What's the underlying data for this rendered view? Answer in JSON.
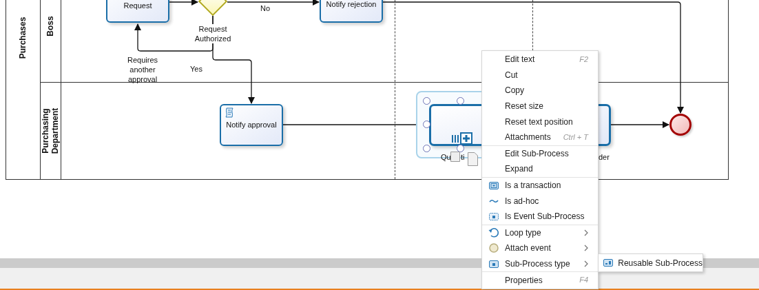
{
  "diagram": {
    "pool": {
      "label": "Purchases"
    },
    "lanes": [
      {
        "label": "Boss"
      },
      {
        "label": "Purchasing Department"
      }
    ],
    "nodes": [
      {
        "kind": "task",
        "label": "Request"
      },
      {
        "kind": "gateway",
        "label": "Request Authorized"
      },
      {
        "kind": "task",
        "label": "Notify rejection"
      },
      {
        "kind": "script-task",
        "label": "Notify approval"
      },
      {
        "kind": "subprocess",
        "selected": true,
        "label_fragments": [
          "Qu",
          "ti",
          "der"
        ]
      },
      {
        "kind": "end-event"
      }
    ],
    "flow_labels": [
      {
        "text": "No"
      },
      {
        "text": "Requires another approval"
      },
      {
        "text": "Yes"
      }
    ]
  },
  "context_menu": {
    "groups": [
      [
        {
          "kind": "plain",
          "label": "Edit text",
          "shortcut": "F2",
          "has_submenu": false
        },
        {
          "kind": "plain",
          "label": "Cut",
          "has_submenu": false
        },
        {
          "kind": "plain",
          "label": "Copy",
          "has_submenu": false
        },
        {
          "kind": "plain",
          "label": "Reset size",
          "has_submenu": false
        },
        {
          "kind": "plain",
          "label": "Reset text position",
          "has_submenu": false
        },
        {
          "kind": "plain",
          "label": "Attachments",
          "shortcut": "Ctrl + T",
          "has_submenu": false
        }
      ],
      [
        {
          "kind": "plain",
          "label": "Edit Sub-Process",
          "has_submenu": false
        },
        {
          "kind": "plain",
          "label": "Expand",
          "has_submenu": false
        }
      ],
      [
        {
          "kind": "transaction",
          "label": "Is a transaction",
          "has_submenu": false
        },
        {
          "kind": "ad-hoc",
          "label": "Is ad-hoc",
          "has_submenu": false
        },
        {
          "kind": "event-subprocess",
          "label": "Is Event Sub-Process",
          "has_submenu": false
        }
      ],
      [
        {
          "kind": "loop",
          "label": "Loop type",
          "has_submenu": true
        },
        {
          "kind": "attach",
          "label": "Attach event",
          "has_submenu": true
        },
        {
          "kind": "subprocess-type",
          "label": "Sub-Process type",
          "has_submenu": true
        }
      ],
      [
        {
          "kind": "plain",
          "label": "Properties",
          "shortcut": "F4",
          "has_submenu": false
        }
      ]
    ],
    "submenu": {
      "items": [
        {
          "kind": "reusable",
          "label": "Reusable Sub-Process"
        }
      ]
    }
  }
}
